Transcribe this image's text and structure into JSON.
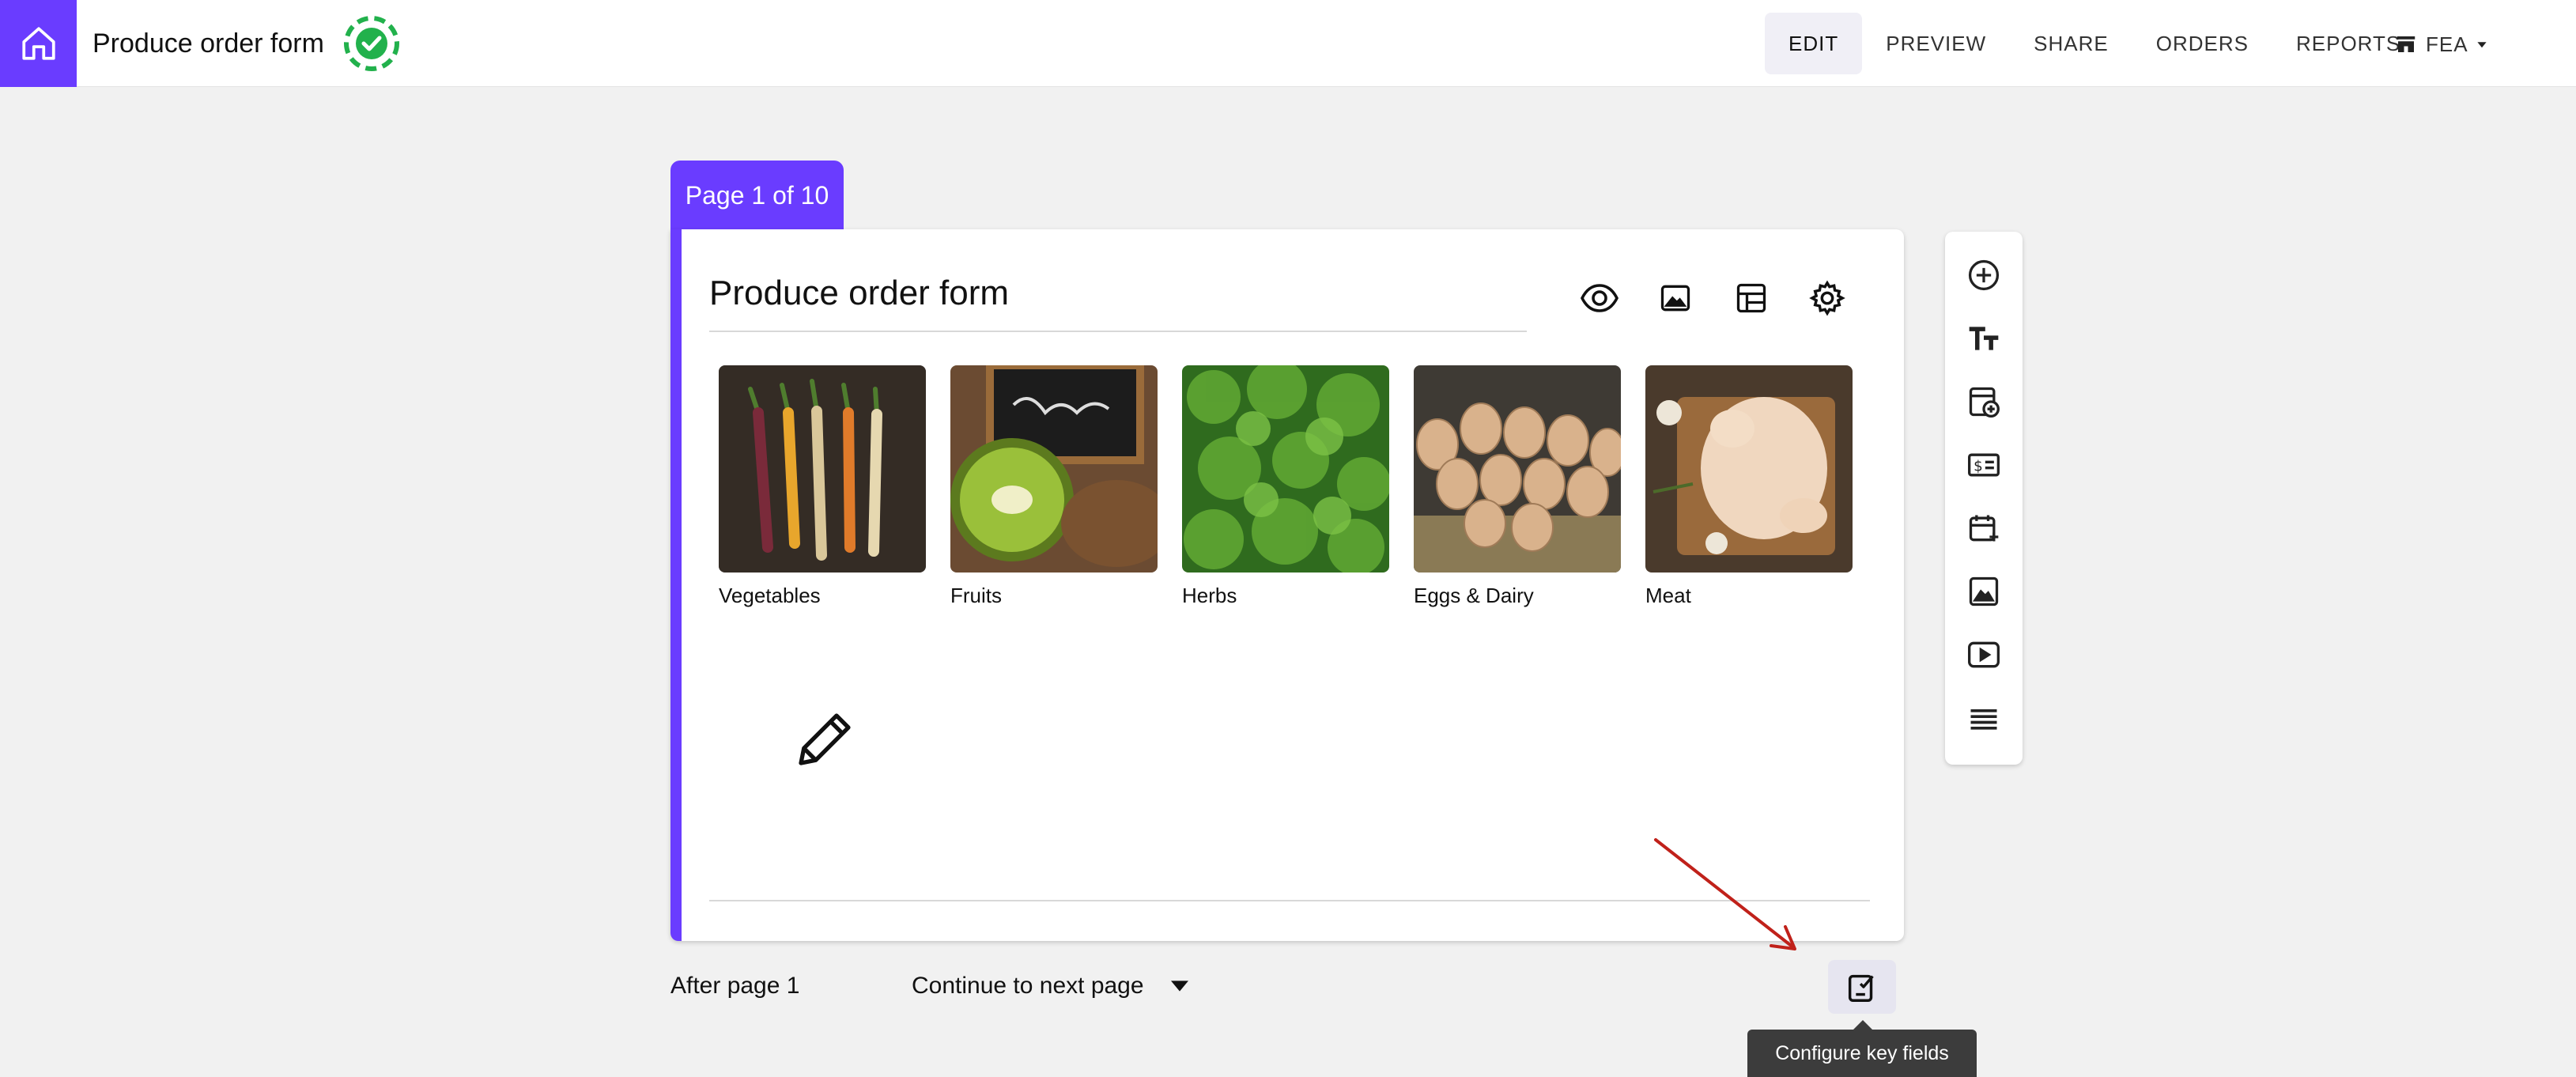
{
  "header": {
    "title": "Produce order form",
    "nav": [
      "EDIT",
      "PREVIEW",
      "SHARE",
      "ORDERS",
      "REPORTS"
    ],
    "active_nav": "EDIT",
    "account": "FEA"
  },
  "page": {
    "tab_label": "Page 1 of 10",
    "form_title": "Produce order form"
  },
  "categories": [
    {
      "label": "Vegetables"
    },
    {
      "label": "Fruits"
    },
    {
      "label": "Herbs"
    },
    {
      "label": "Eggs & Dairy"
    },
    {
      "label": "Meat"
    }
  ],
  "footer": {
    "after_label": "After page 1",
    "next_action": "Continue to next page",
    "tooltip": "Configure key fields"
  },
  "colors": {
    "accent": "#6a3cff",
    "status_green": "#22b14c",
    "annotation_red": "#c0211a"
  },
  "icons": {
    "card_tools": [
      "eye-icon",
      "image-icon",
      "layout-icon",
      "gear-icon"
    ],
    "right_toolbar": [
      "add-circle-icon",
      "text-size-icon",
      "product-add-icon",
      "price-tag-icon",
      "calendar-add-icon",
      "image-icon",
      "video-icon",
      "divider-icon"
    ]
  }
}
